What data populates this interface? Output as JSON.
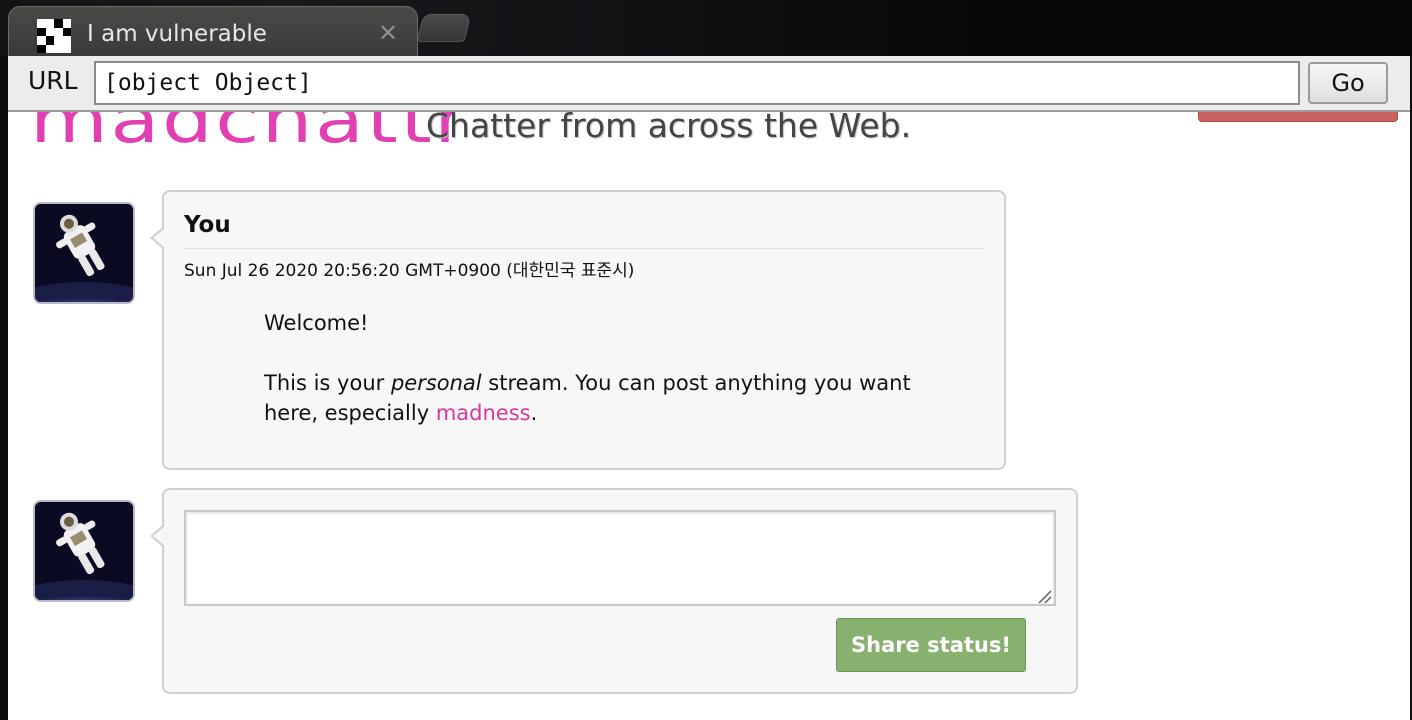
{
  "browser": {
    "tab_title": "I am vulnerable",
    "tab_close_glyph": "✕",
    "url_label": "URL",
    "url_value": "[object Object]",
    "go_label": "Go"
  },
  "site": {
    "logo_text": "madchattr",
    "tagline": "Chatter from across the Web.",
    "accent_color": "#e23fb3"
  },
  "post": {
    "author": "You",
    "timestamp": "Sun Jul 26 2020 20:56:20 GMT+0900 (대한민국 표준시)",
    "line1": "Welcome!",
    "line2_before": "This is your ",
    "line2_em": "personal",
    "line2_after": " stream. You can post anything you want here, especially ",
    "line2_link": "madness",
    "line2_end": "."
  },
  "composer": {
    "textarea_value": "",
    "share_label": "Share status!",
    "share_color": "#88b06e"
  },
  "icons": {
    "favicon": "checker-favicon-icon",
    "avatar": "astronaut-avatar-icon"
  }
}
